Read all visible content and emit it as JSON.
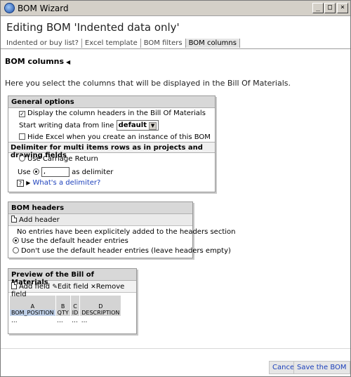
{
  "window": {
    "title": "BOM Wizard",
    "controls": {
      "minimize": "_",
      "maximize": "□",
      "close": "×"
    }
  },
  "header": {
    "title": "Editing BOM 'Indented data only'",
    "tabs": [
      {
        "label": "Indented or buy list?"
      },
      {
        "label": "Excel template"
      },
      {
        "label": "BOM filters"
      },
      {
        "label": "BOM columns"
      }
    ],
    "active_tab": "BOM columns"
  },
  "section": {
    "title": "BOM columns",
    "intro": "Here you select the columns that will be displayed in the Bill Of Materials."
  },
  "general_options": {
    "title": "General options",
    "display_headers_label": "Display the column headers in the Bill Of Materials",
    "display_headers_checked": true,
    "start_line_label": "Start writing data from line",
    "start_line_value": "default",
    "hide_excel_label": "Hide Excel when you create an instance of this BOM",
    "hide_excel_checked": false,
    "delimiter_title": "Delimiter for multi items rows as in projects and drawing fields",
    "carriage_return_label": "Use Carriage Return",
    "use_label": "Use",
    "delimiter_value": ",",
    "as_delimiter_label": "as delimiter",
    "help_link": "What's a delimiter?"
  },
  "bom_headers": {
    "title": "BOM headers",
    "add_header_label": "Add header",
    "no_entries_text": "No entries have been explicitely added to the headers section",
    "use_default_label": "Use the default header entries",
    "dont_use_default_label": "Don't use the default header entries (leave headers empty)",
    "selected": "use_default"
  },
  "preview": {
    "title": "Preview of the Bill of Materials",
    "add_field_label": "Add field",
    "edit_field_label": "Edit field",
    "remove_field_label": "Remove field",
    "columns": [
      {
        "letter": "A",
        "field": "BOM_POSITION",
        "value": "..."
      },
      {
        "letter": "B",
        "field": "QTY",
        "value": "..."
      },
      {
        "letter": "C",
        "field": "ID",
        "value": "..."
      },
      {
        "letter": "D",
        "field": "DESCRIPTION",
        "value": "..."
      }
    ]
  },
  "footer": {
    "cancel_label": "Cancel",
    "save_label": "Save the BOM"
  },
  "icons": {
    "app": "app-icon",
    "help": "help-icon",
    "expand": "triangle-right-icon",
    "doc": "document-icon",
    "edit": "pencil-icon",
    "remove": "x-icon"
  },
  "colors": {
    "link": "#1b3fbb",
    "panel_header": "#d8d8d8",
    "selected_field": "#bfd0e8"
  }
}
